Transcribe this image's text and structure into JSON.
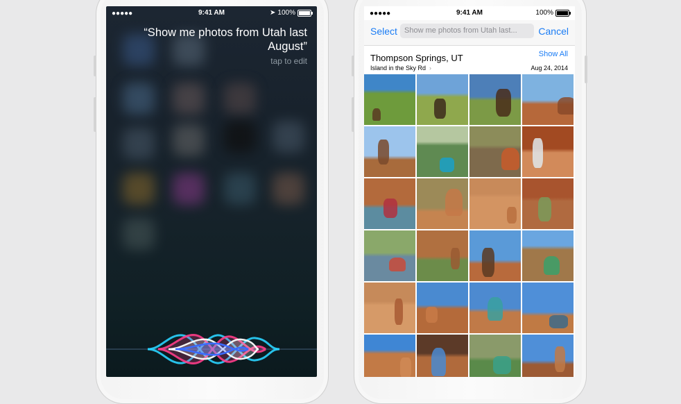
{
  "siri_screen": {
    "status": {
      "signal": "●●●●●",
      "time": "9:41 AM",
      "battery": "100%"
    },
    "query": "“Show me photos from Utah last August”",
    "hint": "tap to edit"
  },
  "photos_screen": {
    "status": {
      "signal": "●●●●●",
      "time": "9:41 AM",
      "battery": "100%"
    },
    "nav": {
      "select_label": "Select",
      "search_value": "Show me photos from Utah last...",
      "cancel_label": "Cancel"
    },
    "moment": {
      "title": "Thompson Springs, UT",
      "subtitle": "Island in the Sky Rd",
      "show_all_label": "Show All",
      "date": "Aug 24, 2014"
    },
    "photos": [
      {
        "sky": "#3f86c8",
        "ground": "#6e9b3c",
        "fig": "#5a3a22"
      },
      {
        "sky": "#6ea3d8",
        "ground": "#8fa84d",
        "fig": "#3d2a1c"
      },
      {
        "sky": "#4d7fb8",
        "ground": "#7c9a46",
        "fig": "#4a2d1a"
      },
      {
        "sky": "#7eb2e0",
        "ground": "#b6683a",
        "fig": "#8a4a2a"
      },
      {
        "sky": "#9cc4ec",
        "ground": "#a86b3c",
        "fig": "#7a4a2c"
      },
      {
        "sky": "#b5c7a0",
        "ground": "#5f8a52",
        "fig": "#1aa0c8"
      },
      {
        "sky": "#8c8c5a",
        "ground": "#7e6a4c",
        "fig": "#c85a2a"
      },
      {
        "sky": "#a24a22",
        "ground": "#d28a5a",
        "fig": "#e0e6ea"
      },
      {
        "sky": "#b36a3c",
        "ground": "#5c8ca0",
        "fig": "#b03040"
      },
      {
        "sky": "#9c8a58",
        "ground": "#c58450",
        "fig": "#c47848"
      },
      {
        "sky": "#c88a5a",
        "ground": "#d39462",
        "fig": "#b87040"
      },
      {
        "sky": "#a8542e",
        "ground": "#b06a40",
        "fig": "#7a9a5a"
      },
      {
        "sky": "#8aa86a",
        "ground": "#6a8aa0",
        "fig": "#c84a3a"
      },
      {
        "sky": "#b07040",
        "ground": "#6c8c4a",
        "fig": "#9a5a32"
      },
      {
        "sky": "#5a9ad8",
        "ground": "#b86a3c",
        "fig": "#5a3a22"
      },
      {
        "sky": "#6aa6e0",
        "ground": "#a0784a",
        "fig": "#3aa06a"
      },
      {
        "sky": "#c68a5a",
        "ground": "#d69a68",
        "fig": "#a85a34"
      },
      {
        "sky": "#4a8ad0",
        "ground": "#b46a3a",
        "fig": "#c87a48"
      },
      {
        "sky": "#4d8ad0",
        "ground": "#c07a48",
        "fig": "#3aa0a0"
      },
      {
        "sky": "#4f8fd8",
        "ground": "#c07a44",
        "fig": "#3c6a8a"
      },
      {
        "sky": "#3f86d4",
        "ground": "#c27a46",
        "fig": "#d08a56"
      },
      {
        "sky": "#5c3a28",
        "ground": "#b06a3c",
        "fig": "#4a8ad0"
      },
      {
        "sky": "#8a9a6a",
        "ground": "#5a8a4a",
        "fig": "#3aa08a"
      },
      {
        "sky": "#4f8fd8",
        "ground": "#9c5a34",
        "fig": "#c07a48"
      }
    ]
  }
}
